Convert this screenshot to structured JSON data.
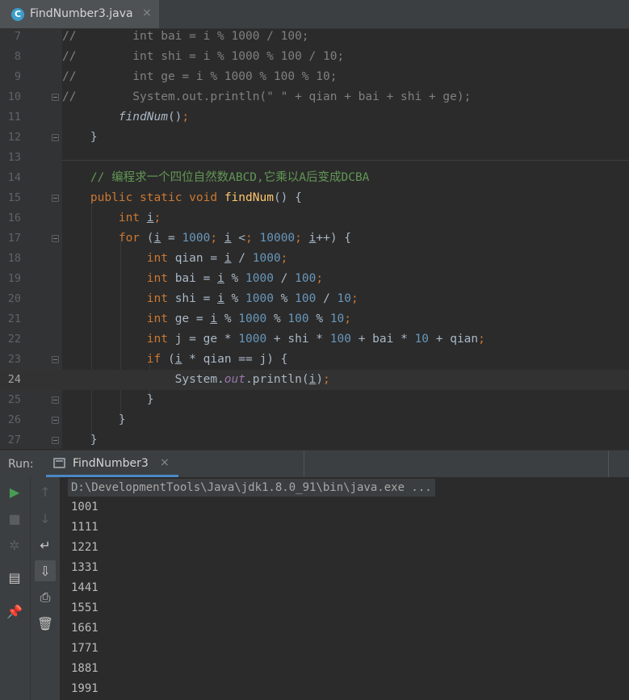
{
  "editor_tab": {
    "title": "FindNumber3.java",
    "close": "×",
    "icon_letter": "C"
  },
  "code_lines": [
    {
      "num": "7",
      "code": "//        int bai = i % 1000 / 100;"
    },
    {
      "num": "8",
      "code": "//        int shi = i % 1000 % 100 / 10;"
    },
    {
      "num": "9",
      "code": "//        int ge = i % 1000 % 100 % 10;"
    },
    {
      "num": "10",
      "code": "//        System.out.println(\" \" + qian + bai + shi + ge);"
    },
    {
      "num": "11",
      "code": "        findNum();"
    },
    {
      "num": "12",
      "code": "    }"
    },
    {
      "num": "13",
      "code": ""
    },
    {
      "num": "14",
      "code": "    // 编程求一个四位自然数ABCD,它乘以A后变成DCBA"
    },
    {
      "num": "15",
      "code": "    public static void findNum() {"
    },
    {
      "num": "16",
      "code": "        int i;"
    },
    {
      "num": "17",
      "code": "        for (i = 1000; i < 10000; i++) {"
    },
    {
      "num": "18",
      "code": "            int qian = i / 1000;"
    },
    {
      "num": "19",
      "code": "            int bai = i % 1000 / 100;"
    },
    {
      "num": "20",
      "code": "            int shi = i % 1000 % 100 / 10;"
    },
    {
      "num": "21",
      "code": "            int ge = i % 1000 % 100 % 10;"
    },
    {
      "num": "22",
      "code": "            int j = ge * 1000 + shi * 100 + bai * 10 + qian;"
    },
    {
      "num": "23",
      "code": "            if (i * qian == j) {"
    },
    {
      "num": "24",
      "code": "                System.out.println(i);"
    },
    {
      "num": "25",
      "code": "            }"
    },
    {
      "num": "26",
      "code": "        }"
    },
    {
      "num": "27",
      "code": "    }"
    }
  ],
  "current_line": "24",
  "run_panel": {
    "label": "Run:",
    "tab_title": "FindNumber3",
    "close": "×",
    "command": "D:\\DevelopmentTools\\Java\\jdk1.8.0_91\\bin\\java.exe ...",
    "output": [
      "1001",
      "1111",
      "1221",
      "1331",
      "1441",
      "1551",
      "1661",
      "1771",
      "1881",
      "1991"
    ]
  },
  "toolbar_left": [
    {
      "name": "rerun-icon",
      "glyph": "▶",
      "color": "#499c54"
    },
    {
      "name": "stop-icon",
      "glyph": "■",
      "color": "#5a5d5f"
    },
    {
      "name": "debug-bug-icon",
      "glyph": "✲",
      "color": "#5a5d5f"
    },
    {
      "name": "layout-icon",
      "glyph": "▤",
      "color": "#c9c9c9"
    },
    {
      "name": "pin-icon",
      "glyph": "📌",
      "color": "#c9c9c9"
    }
  ],
  "toolbar_right": [
    {
      "name": "up-arrow-icon",
      "glyph": "↑",
      "color": "#5a5d5f"
    },
    {
      "name": "down-arrow-icon",
      "glyph": "↓",
      "color": "#5a5d5f"
    },
    {
      "name": "soft-wrap-icon",
      "glyph": "↵",
      "color": "#c9c9c9"
    },
    {
      "name": "scroll-to-end-icon",
      "glyph": "⇩",
      "color": "#c9c9c9"
    },
    {
      "name": "print-icon",
      "glyph": "⎙",
      "color": "#c9c9c9"
    },
    {
      "name": "trash-icon",
      "glyph": "🗑",
      "color": "#c9c9c9"
    }
  ]
}
